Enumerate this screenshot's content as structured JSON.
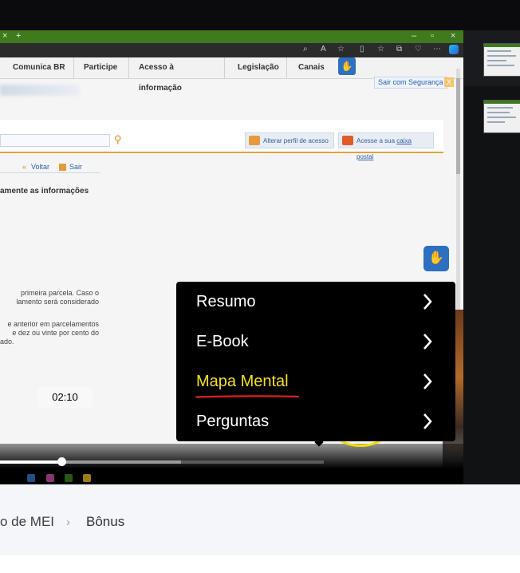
{
  "browser": {
    "tab_close": "×",
    "tab_new": "+",
    "window_controls": [
      "–",
      "▫",
      "×"
    ],
    "gov_nav": [
      "Comunica BR",
      "Participe",
      "Acesso à informação",
      "Legislação",
      "Canais"
    ],
    "sair_seguranca": "Sair com Segurança",
    "sair_seguranca_close": "X"
  },
  "page": {
    "alterar_perfil": "Alterar perfil de acesso",
    "caixa_postal_prefix": "Acesse a sua ",
    "caixa_postal_link": "caixa postal",
    "voltar": "Voltar",
    "sair": "Sair",
    "heading_fragment": "amente as informações",
    "para1_line1": "primeira parcela. Caso o",
    "para1_line2": "lamento será considerado",
    "para2_line1": "e anterior em parcelamentos",
    "para2_line2": "e dez ou vinte por cento do",
    "para2_line3": "ado."
  },
  "player": {
    "time_tooltip": "02:10",
    "progress_fraction": 0.19,
    "buffered_fraction": 0.56,
    "menu": {
      "items": [
        {
          "label": "Resumo"
        },
        {
          "label": "E-Book"
        },
        {
          "label": "Mapa Mental"
        },
        {
          "label": "Perguntas"
        }
      ],
      "active_index": 2
    },
    "icons": [
      "search-icon",
      "sparkle-ai-icon",
      "settings-gear-icon",
      "cast-icon",
      "fullscreen-icon"
    ]
  },
  "breadcrumb": {
    "item1": "o de MEI",
    "separator": "›",
    "item2": "Bônus"
  },
  "colors": {
    "highlight": "#f5e000",
    "active_menu": "#f5e11a",
    "underline": "#e0201c",
    "browser_tab_green": "#3f7a1f",
    "libras_blue": "#2d6fc1"
  }
}
